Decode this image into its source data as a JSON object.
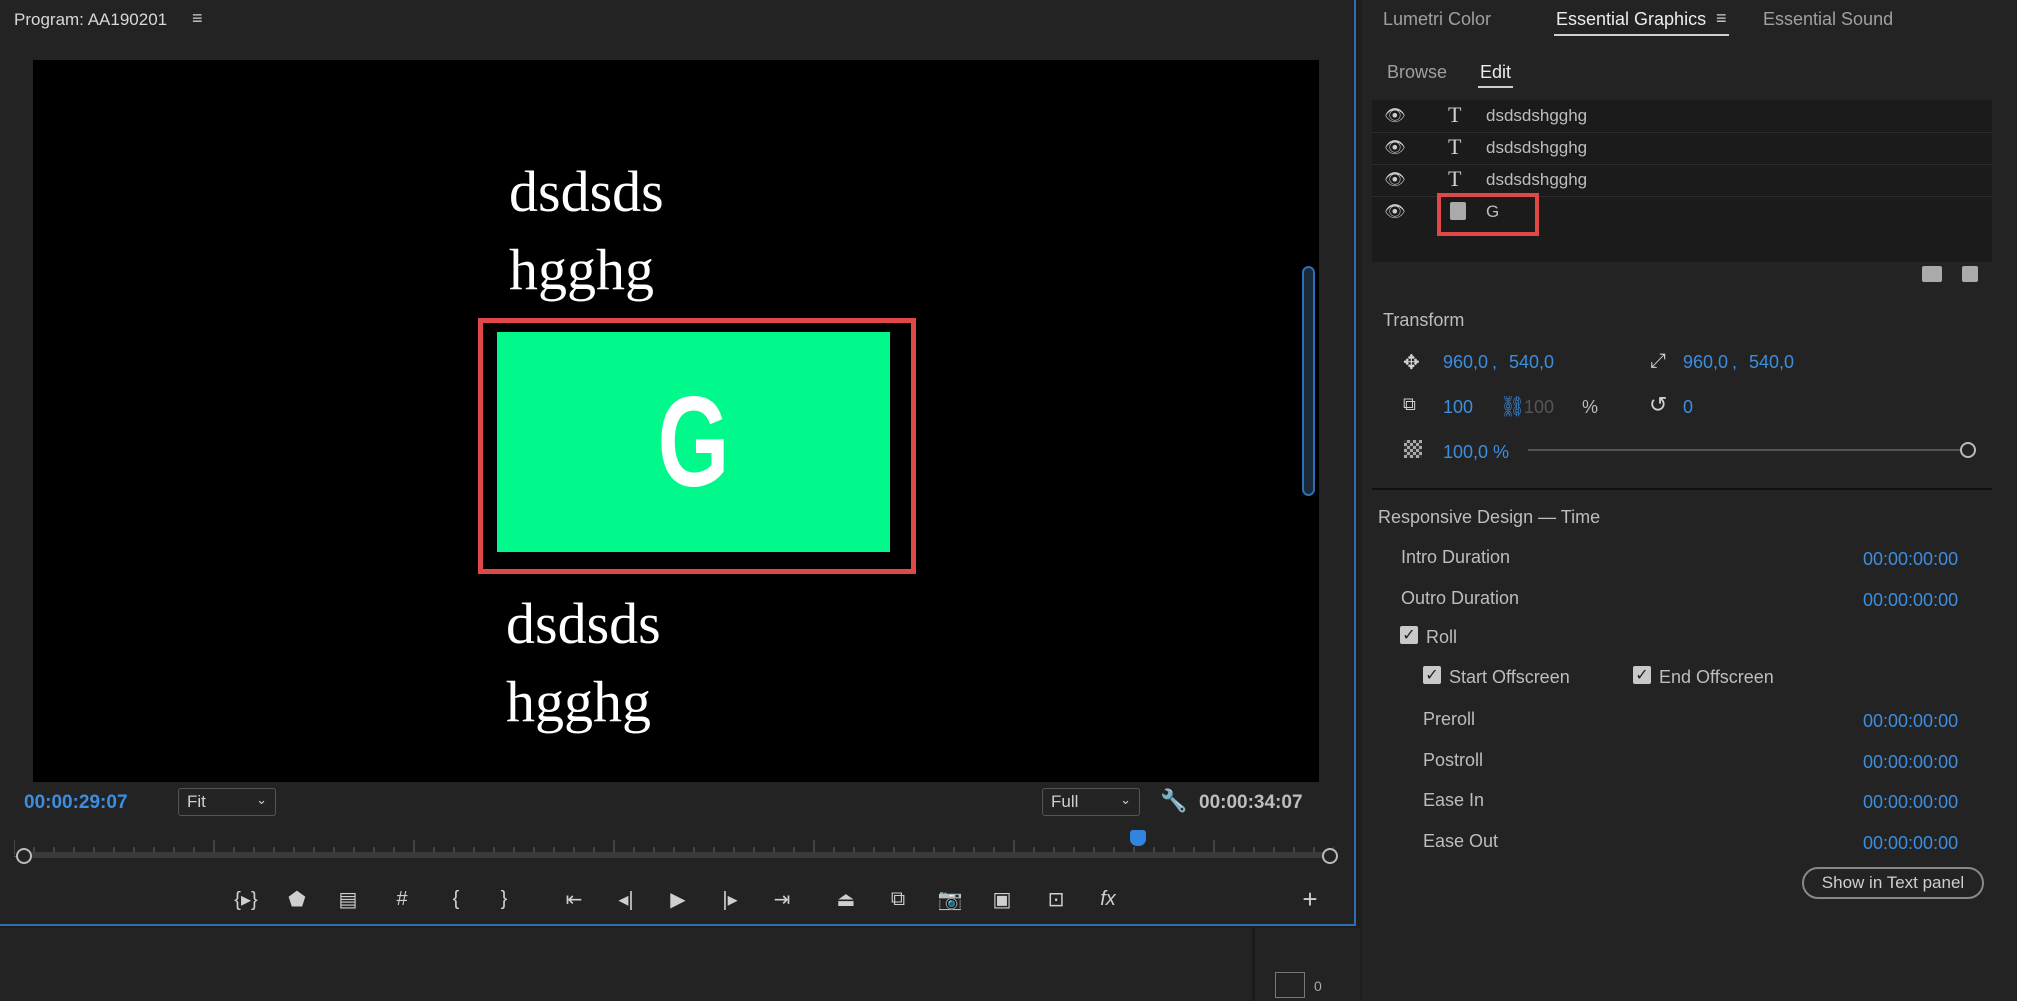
{
  "program": {
    "title": "Program: AA190201",
    "menu_icon": "hamburger-icon",
    "text_top_line1": "dsdsds",
    "text_top_line2": "hgghg",
    "graphic_letter": "G",
    "text_bottom_line1": "dsdsds",
    "text_bottom_line2": "hgghg",
    "green_color": "#00f98a",
    "selection_color": "#e04848",
    "current_timecode": "00:00:29:07",
    "fit_label": "Fit",
    "quality_label": "Full",
    "duration_timecode": "00:00:34:07"
  },
  "transport_icons": [
    "mark-in-out-icon",
    "add-marker-icon",
    "mark-clip-icon",
    "safe-margins-icon",
    "mark-in-icon",
    "mark-out-icon",
    "go-to-in-icon",
    "step-back-icon",
    "play-icon",
    "step-forward-icon",
    "go-to-out-icon",
    "lift-icon",
    "extract-icon",
    "export-frame-icon",
    "comparison-view-icon",
    "vr-video-icon",
    "fx-icon",
    "add-button-icon"
  ],
  "panel": {
    "tabs": [
      "Lumetri Color",
      "Essential Graphics",
      "Essential Sound"
    ],
    "subtabs": [
      "Browse",
      "Edit"
    ],
    "layers": [
      {
        "name": "dsdsdshgghg",
        "icon": "text-layer-icon"
      },
      {
        "name": "dsdsdshgghg",
        "icon": "text-layer-icon"
      },
      {
        "name": "dsdsdshgghg",
        "icon": "text-layer-icon"
      },
      {
        "name": "G",
        "icon": "clip-layer-icon"
      }
    ],
    "transform": {
      "title": "Transform",
      "position_x": "960,0",
      "position_y": "540,0",
      "anchor_x": "960,0",
      "anchor_y": "540,0",
      "scale": "100",
      "scale_height": "100",
      "percent": "%",
      "rotation": "0",
      "opacity": "100,0 %",
      "comma": ","
    },
    "responsive": {
      "title": "Responsive Design — Time",
      "intro_label": "Intro Duration",
      "intro_value": "00:00:00:00",
      "outro_label": "Outro Duration",
      "outro_value": "00:00:00:00",
      "roll_label": "Roll",
      "start_offscreen_label": "Start Offscreen",
      "end_offscreen_label": "End Offscreen",
      "preroll_label": "Preroll",
      "preroll_value": "00:00:00:00",
      "postroll_label": "Postroll",
      "postroll_value": "00:00:00:00",
      "ease_in_label": "Ease In",
      "ease_in_value": "00:00:00:00",
      "ease_out_label": "Ease Out",
      "ease_out_value": "00:00:00:00"
    },
    "show_in_text_panel": "Show in Text panel"
  },
  "bottom": {
    "counter": "0"
  }
}
